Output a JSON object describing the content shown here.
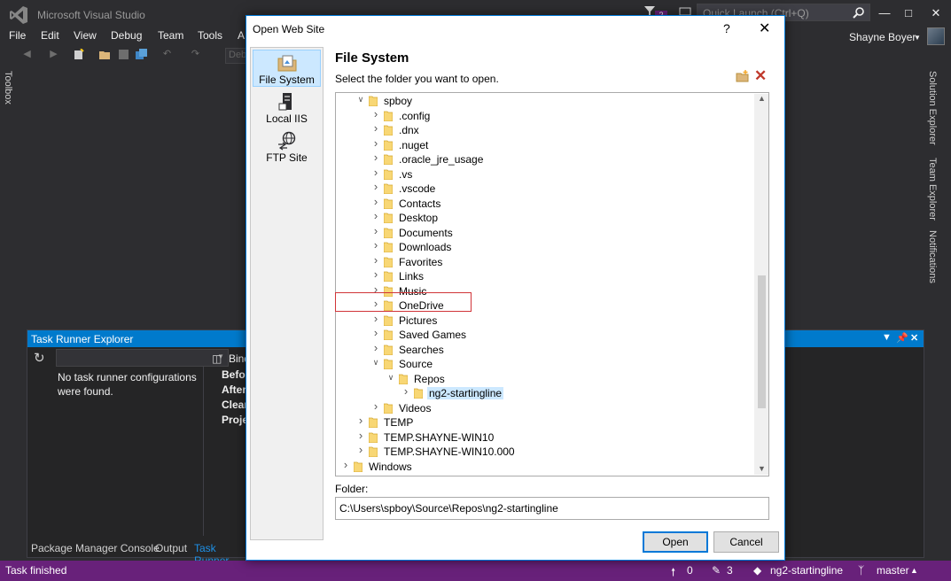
{
  "vs": {
    "title": "Microsoft Visual Studio",
    "notification_count": "2",
    "quick_launch_placeholder": "Quick Launch (Ctrl+Q)",
    "user_name": "Shayne Boyer",
    "menu": [
      "File",
      "Edit",
      "View",
      "Debug",
      "Team",
      "Tools",
      "A"
    ],
    "debug_combo": "Deb",
    "toolbox_tab": "Toolbox",
    "right_tabs": [
      "Solution Explorer",
      "Team Explorer",
      "Notifications"
    ]
  },
  "task_runner": {
    "title": "Task Runner Explorer",
    "message": "No task runner configurations were found.",
    "bindings_label": "Bind",
    "binding_rows": [
      "Befor",
      "After",
      "Clean",
      "Proje"
    ],
    "bottom_tabs": [
      "Package Manager Console",
      "Output",
      "Task Runner"
    ]
  },
  "status_bar": {
    "text": "Task finished",
    "up_count": "0",
    "pending_count": "3",
    "repo": "ng2-startingline",
    "branch": "master"
  },
  "dialog": {
    "title": "Open Web Site",
    "help": "?",
    "nav": [
      {
        "label": "File System",
        "icon": "folder-page-icon",
        "selected": true
      },
      {
        "label": "Local IIS",
        "icon": "server-icon",
        "selected": false
      },
      {
        "label": "FTP Site",
        "icon": "globe-icon",
        "selected": false
      }
    ],
    "section_title": "File System",
    "section_subtitle": "Select the folder you want to open.",
    "tree": [
      {
        "label": "spboy",
        "depth": 3,
        "state": "open"
      },
      {
        "label": ".config",
        "depth": 4,
        "state": "closed"
      },
      {
        "label": ".dnx",
        "depth": 4,
        "state": "closed"
      },
      {
        "label": ".nuget",
        "depth": 4,
        "state": "closed"
      },
      {
        "label": ".oracle_jre_usage",
        "depth": 4,
        "state": "closed"
      },
      {
        "label": ".vs",
        "depth": 4,
        "state": "closed"
      },
      {
        "label": ".vscode",
        "depth": 4,
        "state": "closed"
      },
      {
        "label": "Contacts",
        "depth": 4,
        "state": "closed"
      },
      {
        "label": "Desktop",
        "depth": 4,
        "state": "closed"
      },
      {
        "label": "Documents",
        "depth": 4,
        "state": "closed"
      },
      {
        "label": "Downloads",
        "depth": 4,
        "state": "closed"
      },
      {
        "label": "Favorites",
        "depth": 4,
        "state": "closed"
      },
      {
        "label": "Links",
        "depth": 4,
        "state": "closed"
      },
      {
        "label": "Music",
        "depth": 4,
        "state": "closed"
      },
      {
        "label": "OneDrive",
        "depth": 4,
        "state": "closed"
      },
      {
        "label": "Pictures",
        "depth": 4,
        "state": "closed"
      },
      {
        "label": "Saved Games",
        "depth": 4,
        "state": "closed"
      },
      {
        "label": "Searches",
        "depth": 4,
        "state": "closed"
      },
      {
        "label": "Source",
        "depth": 4,
        "state": "open"
      },
      {
        "label": "Repos",
        "depth": 5,
        "state": "open"
      },
      {
        "label": "ng2-startingline",
        "depth": 6,
        "state": "closed",
        "selected": true
      },
      {
        "label": "Videos",
        "depth": 4,
        "state": "closed"
      },
      {
        "label": "TEMP",
        "depth": 3,
        "state": "closed"
      },
      {
        "label": "TEMP.SHAYNE-WIN10",
        "depth": 3,
        "state": "closed"
      },
      {
        "label": "TEMP.SHAYNE-WIN10.000",
        "depth": 3,
        "state": "closed"
      },
      {
        "label": "Windows",
        "depth": 2,
        "state": "closed"
      }
    ],
    "folder_label": "Folder:",
    "folder_value": "C:\\Users\\spboy\\Source\\Repos\\ng2-startingline",
    "open_button": "Open",
    "cancel_button": "Cancel"
  }
}
